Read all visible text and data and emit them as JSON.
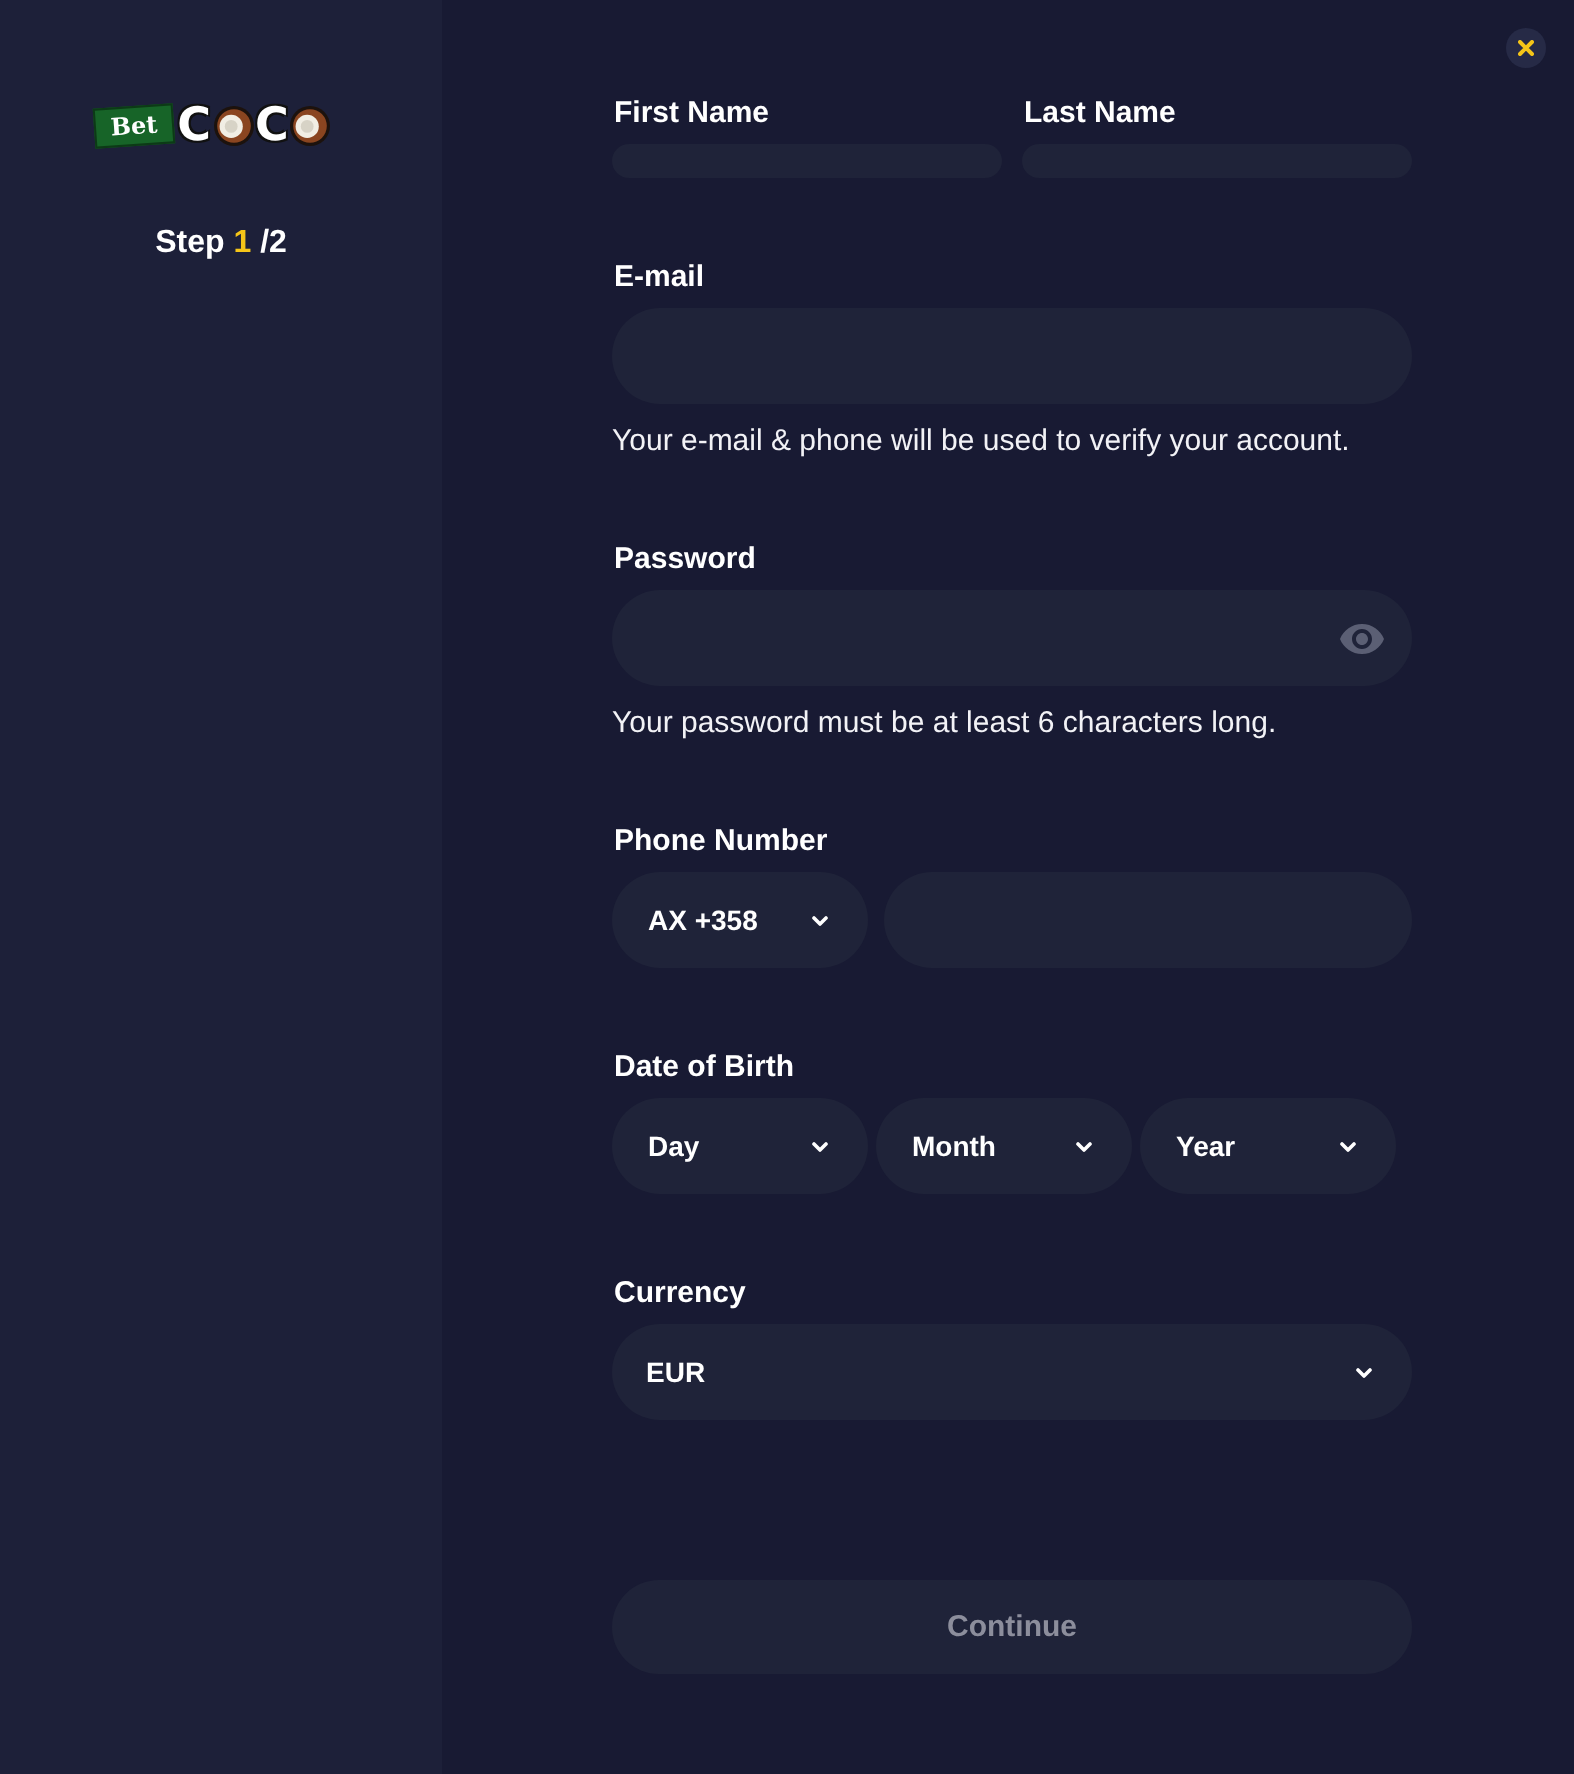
{
  "sidebar": {
    "logo": {
      "badge": "Bet",
      "wordmark": [
        {
          "kind": "letter",
          "text": "C"
        },
        {
          "kind": "coconut"
        },
        {
          "kind": "letter",
          "text": "C"
        },
        {
          "kind": "coconut"
        }
      ]
    },
    "step": {
      "label": "Step",
      "current": "1",
      "total": "/2"
    }
  },
  "form": {
    "groups": [
      {
        "kind": "split",
        "fields": [
          {
            "kind": "input",
            "label": "First Name"
          },
          {
            "kind": "input",
            "label": "Last Name"
          }
        ]
      },
      {
        "kind": "single",
        "label": "E-mail",
        "fields": [
          {
            "kind": "input"
          }
        ],
        "hint": "Your e-mail & phone will be used to verify your account."
      },
      {
        "kind": "single",
        "label": "Password",
        "fields": [
          {
            "kind": "password"
          }
        ],
        "hint": "Your password must be at least 6 characters long."
      },
      {
        "kind": "phone",
        "label": "Phone Number",
        "fields": [
          {
            "kind": "select",
            "value": "AX +358"
          },
          {
            "kind": "input"
          }
        ]
      },
      {
        "kind": "date",
        "label": "Date of Birth",
        "fields": [
          {
            "kind": "select",
            "placeholder": "Day"
          },
          {
            "kind": "select",
            "placeholder": "Month"
          },
          {
            "kind": "select",
            "placeholder": "Year"
          }
        ]
      },
      {
        "kind": "single",
        "label": "Currency",
        "fields": [
          {
            "kind": "select",
            "value": "EUR"
          }
        ]
      }
    ]
  },
  "continue_button": {
    "label": "Continue",
    "disabled": true
  }
}
